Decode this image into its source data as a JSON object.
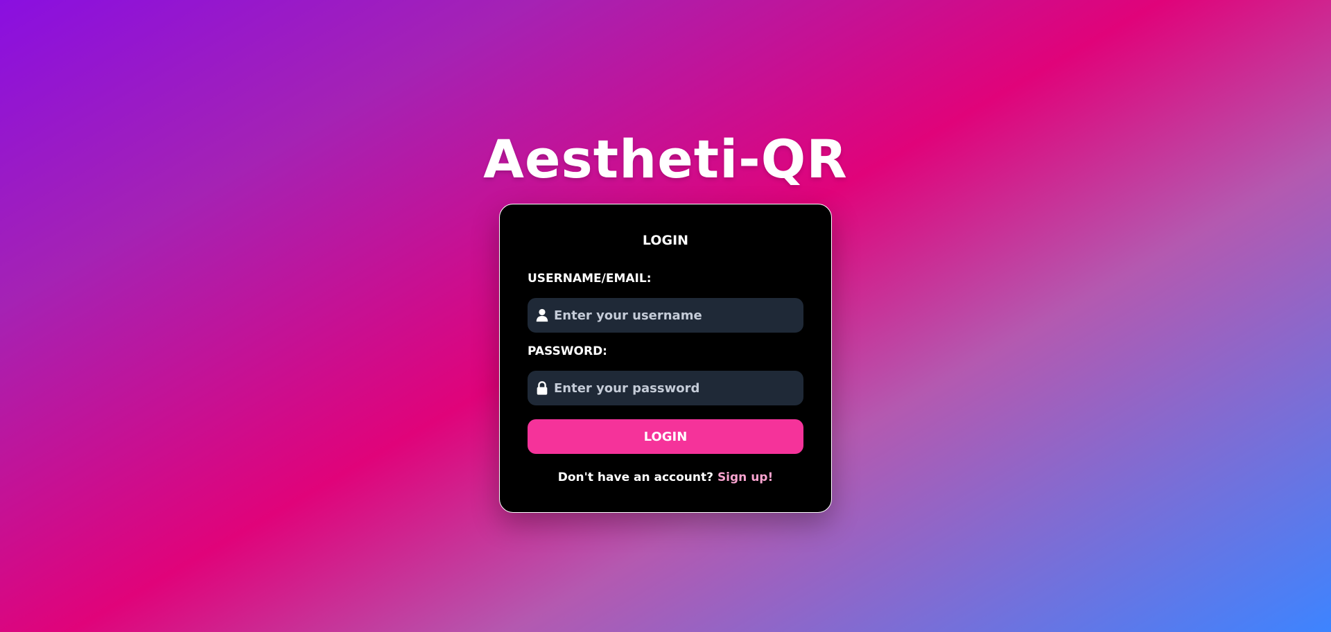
{
  "app": {
    "title": "Aestheti-QR"
  },
  "login_card": {
    "heading": "LOGIN",
    "username": {
      "label": "USERNAME/EMAIL:",
      "placeholder": "Enter your username",
      "value": "",
      "icon": "user-icon"
    },
    "password": {
      "label": "PASSWORD:",
      "placeholder": "Enter your password",
      "value": "",
      "icon": "lock-icon"
    },
    "submit_label": "LOGIN",
    "signup_prompt": "Don't have an account?",
    "signup_link": "Sign up!"
  },
  "colors": {
    "card_background": "#000000",
    "input_background": "#1f2937",
    "button_background": "#f5339a",
    "link_color": "#f9a3cf",
    "text": "#ffffff"
  }
}
